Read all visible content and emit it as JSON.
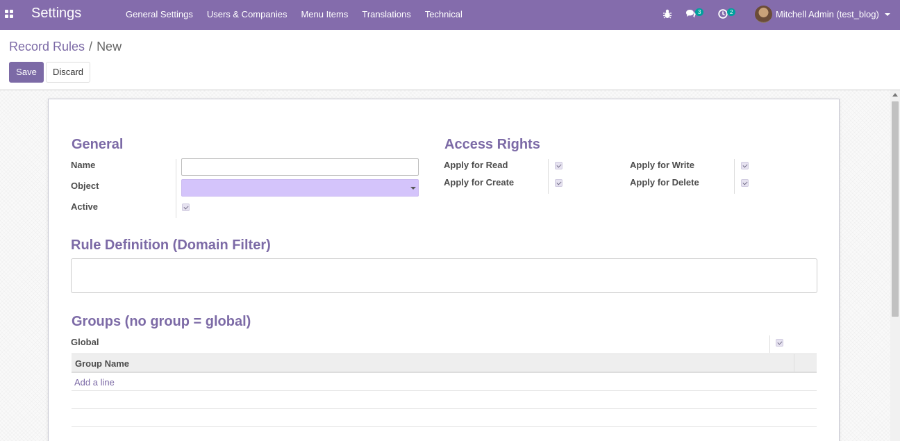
{
  "navbar": {
    "app_name": "Settings",
    "menu": [
      "General Settings",
      "Users & Companies",
      "Menu Items",
      "Translations",
      "Technical"
    ],
    "messages_badge": "3",
    "activities_badge": "2",
    "user_name": "Mitchell Admin (test_blog)"
  },
  "breadcrumb": {
    "parent": "Record Rules",
    "separator": "/",
    "current": "New"
  },
  "toolbar": {
    "save_label": "Save",
    "discard_label": "Discard"
  },
  "form": {
    "general": {
      "title": "General",
      "name_label": "Name",
      "name_value": "",
      "object_label": "Object",
      "object_value": "",
      "active_label": "Active",
      "active_checked": true
    },
    "access_rights": {
      "title": "Access Rights",
      "read_label": "Apply for Read",
      "read_checked": true,
      "write_label": "Apply for Write",
      "write_checked": true,
      "create_label": "Apply for Create",
      "create_checked": true,
      "delete_label": "Apply for Delete",
      "delete_checked": true
    },
    "rule_definition": {
      "title": "Rule Definition (Domain Filter)",
      "value": ""
    },
    "groups": {
      "title": "Groups (no group = global)",
      "global_label": "Global",
      "global_checked": true,
      "column_header": "Group Name",
      "add_line_label": "Add a line"
    }
  },
  "colors": {
    "navbar": "#846cac",
    "accent": "#7c6aa6",
    "required_field": "#d4c4fb"
  }
}
